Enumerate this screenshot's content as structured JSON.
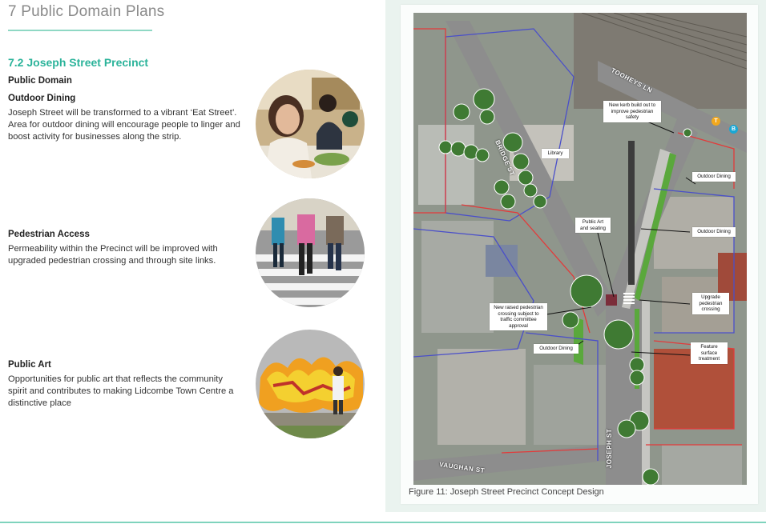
{
  "header": {
    "chapter": "7 Public Domain Plans"
  },
  "section": {
    "title": "7.2 Joseph Street Precinct",
    "subtitle": "Public Domain"
  },
  "items": [
    {
      "heading": "Outdoor Dining",
      "body": "Joseph Street will be transformed to a vibrant ‘Eat Street’. Area for outdoor dining will encourage people to linger and boost activity for businesses along the strip."
    },
    {
      "heading": "Pedestrian Access",
      "body": "Permeability within the Precinct will be improved with upgraded pedestrian crossing and through site links."
    },
    {
      "heading": "Public Art",
      "body": "Opportunities for public art that reflects the community spirit and contributes to making Lidcombe Town Centre a distinctive place"
    }
  ],
  "map": {
    "caption": "Figure 11: Joseph Street Precinct Concept Design",
    "streets": {
      "tooheys": "TOOHEYS LN",
      "bridge": "BRIDGE ST",
      "joseph": "JOSEPH ST",
      "vaughan": "VAUGHAN ST"
    },
    "callouts": {
      "kerb": "New kerb build out to improve pedestrian safety",
      "library": "Library",
      "dining1": "Outdoor Dining",
      "dining2": "Outdoor Dining",
      "art": "Public Art and seating",
      "raised": "New raised pedestrian crossing subject to traffic committee approval",
      "upgrade": "Upgrade pedestrian crossing",
      "dining3": "Outdoor Dining",
      "feature": "Feature surface treatment"
    },
    "badges": {
      "train": "T",
      "bus": "B"
    },
    "colors": {
      "accent": "#2bb39a",
      "boundary_red": "#e23b3b",
      "boundary_blue": "#4a4fc9",
      "landscape": "#5aa83c"
    }
  }
}
